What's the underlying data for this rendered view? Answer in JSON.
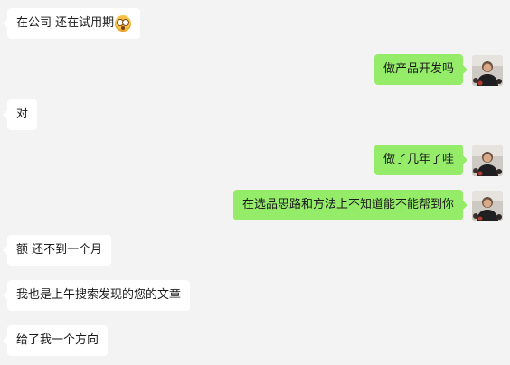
{
  "messages": [
    {
      "text": "在公司 还在试用期",
      "emoji": "flushed-face-emoji"
    },
    {
      "text": "做产品开发吗"
    },
    {
      "text": "对"
    },
    {
      "text": "做了几年了哇"
    },
    {
      "text": "在选品思路和方法上不知道能不能帮到你"
    },
    {
      "text": "额 还不到一个月"
    },
    {
      "text": "我也是上午搜索发现的您的文章"
    },
    {
      "text": "给了我一个方向"
    }
  ],
  "colors": {
    "background": "#f3f3f3",
    "incoming_bubble": "#ffffff",
    "outgoing_bubble": "#95ec69"
  }
}
